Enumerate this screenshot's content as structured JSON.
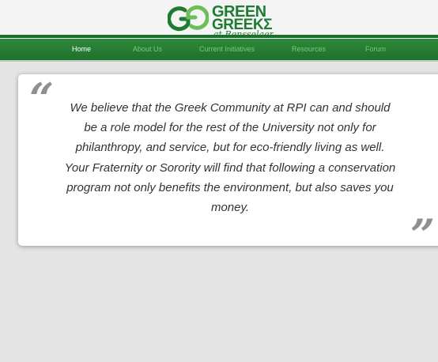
{
  "logo": {
    "word1": "GREEN",
    "word2": "GREEKΣ",
    "tagline": "at Rensselaer",
    "brand_color": "#1e7b32"
  },
  "nav": {
    "items": [
      {
        "label": "Home",
        "active": true
      },
      {
        "label": "About Us",
        "active": false
      },
      {
        "label": "Current Initiatives",
        "active": false
      },
      {
        "label": "Resources",
        "active": false
      },
      {
        "label": "Forum",
        "active": false
      }
    ],
    "bar_color": "#2a7f37",
    "active_text_color": "#ffffff",
    "inactive_text_color": "#79c77f"
  },
  "quote": {
    "open_mark": "“",
    "close_mark": "”",
    "text": "We believe that the Greek Community at RPI can and should be a role model for the rest of the University not only for philanthropy, and service, but for eco-friendly living as well. Your Fraternity or Sorority will find that following a conservation program not only benefits the environment, but also saves you money."
  }
}
